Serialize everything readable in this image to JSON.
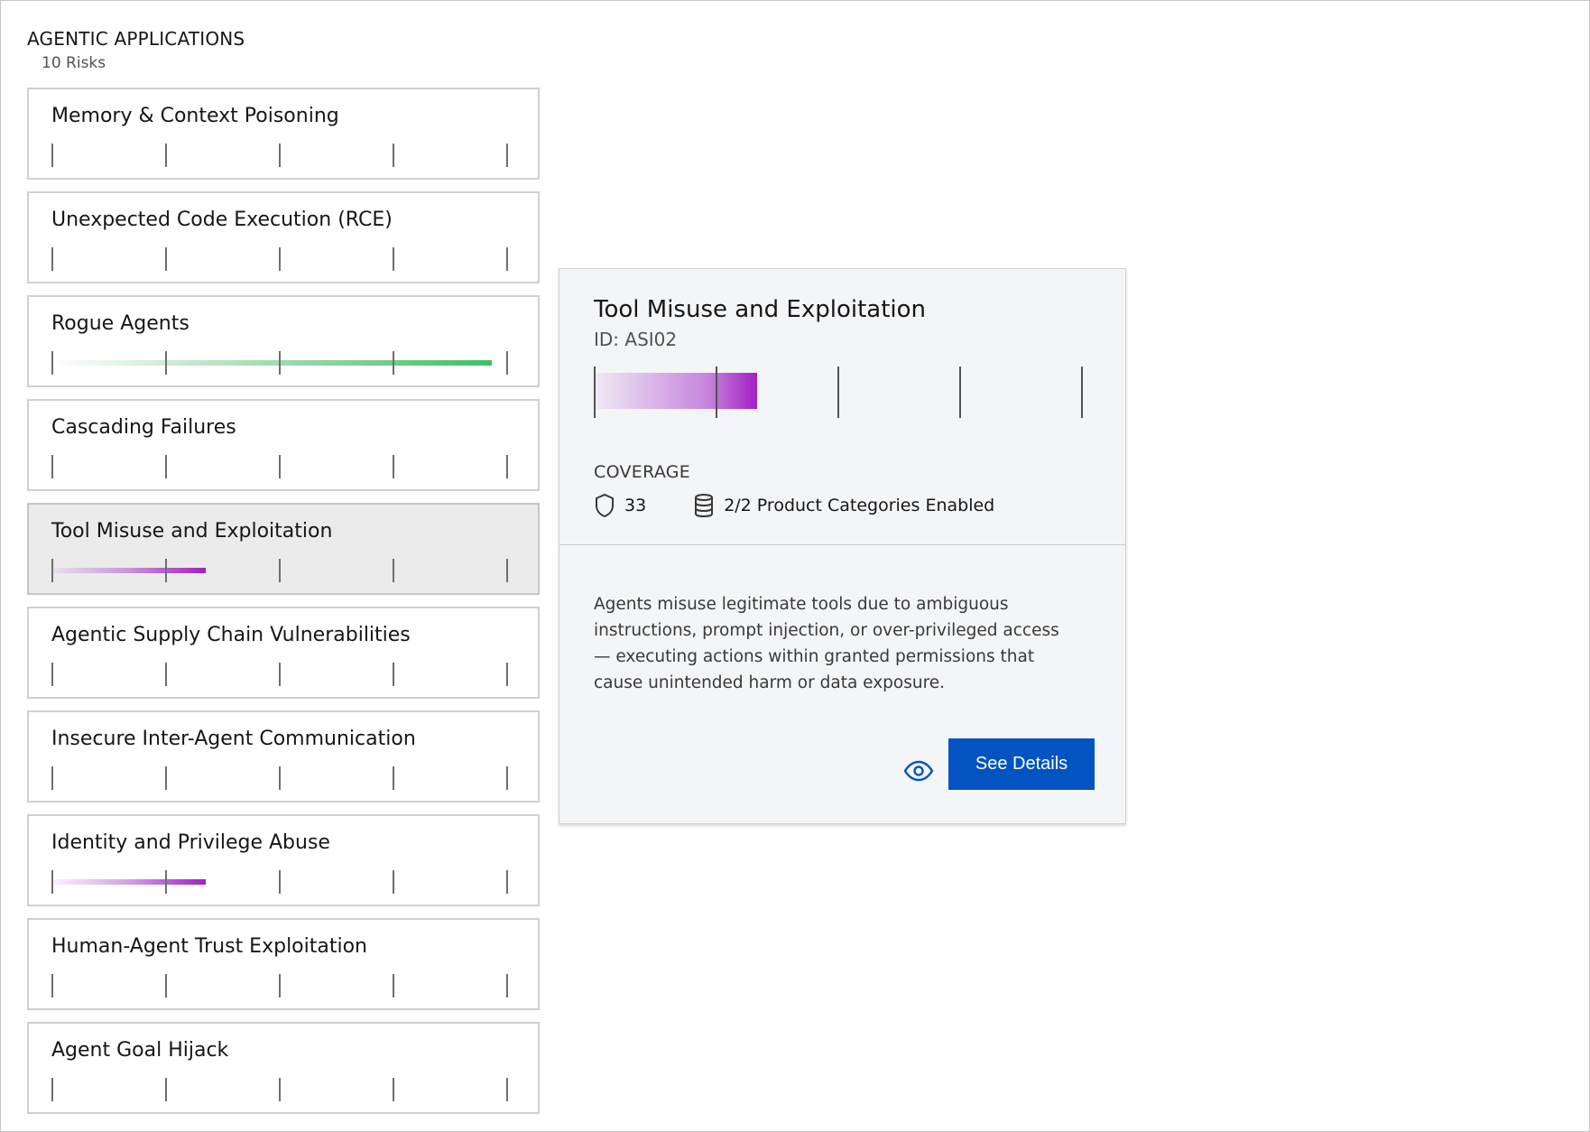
{
  "section": {
    "title": "AGENTIC APPLICATIONS",
    "count": "10 Risks"
  },
  "risks": [
    {
      "name": "Memory & Context Poisoning",
      "level": 0,
      "color": "none"
    },
    {
      "name": "Unexpected Code Execution (RCE)",
      "level": 0,
      "color": "none"
    },
    {
      "name": "Rogue Agents",
      "level": 0.98,
      "color": "green"
    },
    {
      "name": "Cascading Failures",
      "level": 0,
      "color": "none"
    },
    {
      "name": "Tool Misuse and Exploitation",
      "level": 0.34,
      "color": "purple",
      "selected": true
    },
    {
      "name": "Agentic Supply Chain Vulnerabilities",
      "level": 0,
      "color": "none"
    },
    {
      "name": "Insecure Inter-Agent Communication",
      "level": 0,
      "color": "none"
    },
    {
      "name": "Identity and Privilege Abuse",
      "level": 0.34,
      "color": "purple"
    },
    {
      "name": "Human-Agent Trust Exploitation",
      "level": 0,
      "color": "none"
    },
    {
      "name": "Agent Goal Hijack",
      "level": 0,
      "color": "none"
    }
  ],
  "detail": {
    "title": "Tool Misuse and Exploitation",
    "id": "ID: ASI02",
    "level": 0.34,
    "coverage_label": "COVERAGE",
    "controls_count": "33",
    "categories": "2/2 Product Categories Enabled",
    "description": "Agents misuse legitimate tools due to ambiguous instructions, prompt injection, or over-privileged access — executing actions within granted permissions that cause unintended harm or data exposure.",
    "see_details_label": "See Details",
    "icons": {
      "shield": "shield-icon",
      "database": "database-icon",
      "eye": "eye-icon"
    }
  },
  "colors": {
    "accent": "#0353c2",
    "green": "#42be65",
    "purple": "#a21fc4"
  }
}
